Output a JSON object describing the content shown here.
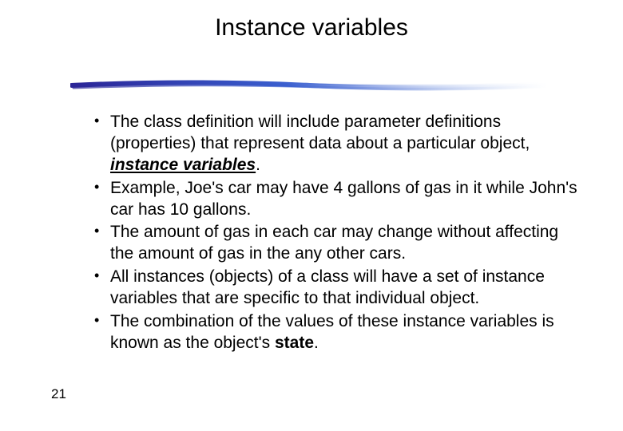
{
  "title": "Instance variables",
  "page_number": "21",
  "divider": {
    "color_start": "#2b2597",
    "color_end": "#9fb9ea"
  },
  "bullets": [
    {
      "segments": [
        {
          "text": "The class definition will include parameter definitions (properties) that represent data about a particular object, "
        },
        {
          "text": "instance variables",
          "bold": true,
          "underline": true,
          "italic": true
        },
        {
          "text": "."
        }
      ]
    },
    {
      "segments": [
        {
          "text": "Example, Joe's car may have 4 gallons of gas in it while John's car has 10 gallons."
        }
      ]
    },
    {
      "segments": [
        {
          "text": "The amount of gas in each car may change without affecting the amount of gas in the any other cars."
        }
      ]
    },
    {
      "segments": [
        {
          "text": "All instances (objects) of a class will have a set of instance variables that are specific to that individual object."
        }
      ]
    },
    {
      "segments": [
        {
          "text": "The combination of the values of these instance variables is known as the object's "
        },
        {
          "text": "state",
          "bold": true
        },
        {
          "text": "."
        }
      ]
    }
  ]
}
